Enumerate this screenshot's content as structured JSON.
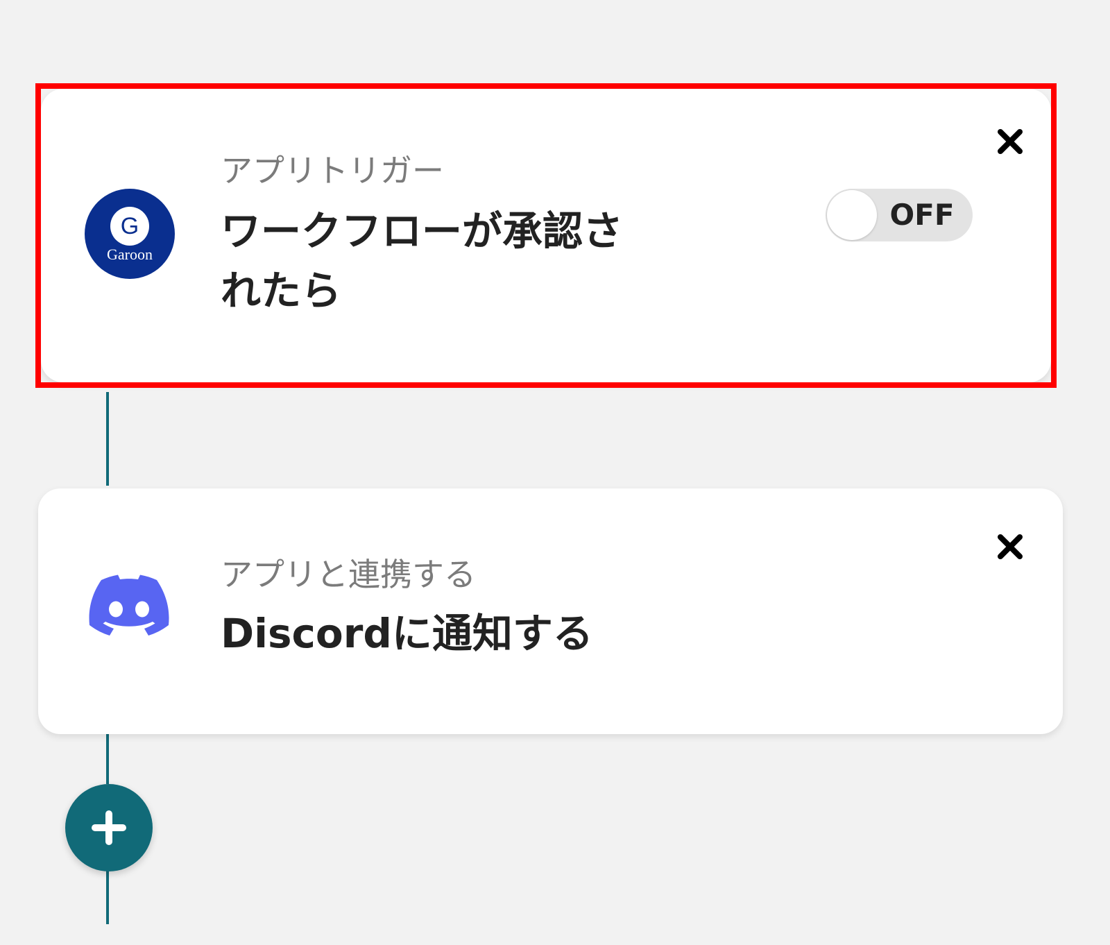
{
  "flow": {
    "steps": [
      {
        "category": "アプリトリガー",
        "title": "ワークフローが承認されたら",
        "app_icon": "garoon-logo",
        "app_logo_text": "Garoon",
        "app_logo_letter": "G",
        "toggle_label": "OFF",
        "toggle_on": false,
        "highlighted": true,
        "close_icon": "close-icon"
      },
      {
        "category": "アプリと連携する",
        "title": "Discordに通知する",
        "app_icon": "discord-logo",
        "close_icon": "close-icon"
      }
    ],
    "add_step_icon": "plus-icon"
  },
  "colors": {
    "page_background": "#f2f2f2",
    "card_background": "#ffffff",
    "highlight_border": "#ff0000",
    "connector": "#116a78",
    "add_button": "#116a78",
    "garoon_brand": "#0a2f8f",
    "discord_brand": "#5865f2",
    "category_text": "#7b7b7b",
    "title_text": "#222222"
  }
}
